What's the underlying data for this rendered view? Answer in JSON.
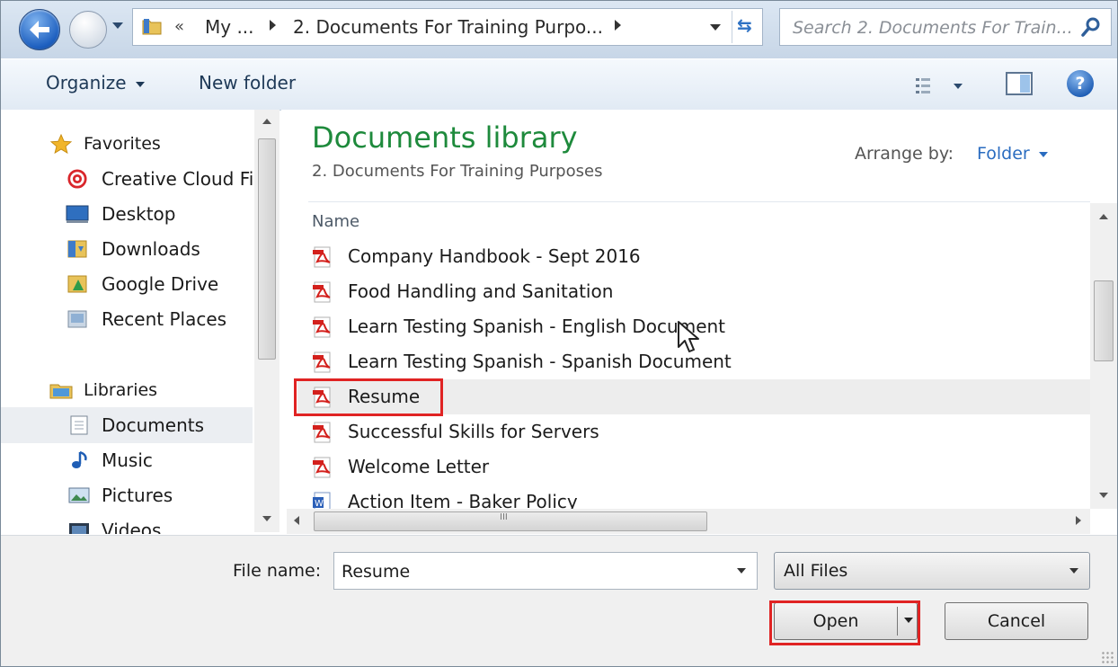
{
  "address": {
    "back_label": "Back",
    "overflow": "«",
    "crumbs": [
      "My ...",
      "2. Documents For Training Purpo..."
    ],
    "search_placeholder": "Search 2. Documents For Train..."
  },
  "toolbar": {
    "organize": "Organize",
    "new_folder": "New folder"
  },
  "nav": {
    "favorites": "Favorites",
    "creative_cloud": "Creative Cloud Fi",
    "desktop": "Desktop",
    "downloads": "Downloads",
    "google_drive": "Google Drive",
    "recent_places": "Recent Places",
    "libraries": "Libraries",
    "documents": "Documents",
    "music": "Music",
    "pictures": "Pictures",
    "videos": "Videos"
  },
  "library": {
    "title": "Documents library",
    "subtitle": "2. Documents For Training Purposes",
    "arrange_label": "Arrange by:",
    "arrange_value": "Folder",
    "column_name": "Name"
  },
  "files": [
    {
      "name": "Company Handbook - Sept 2016",
      "icon": "pdf-icon"
    },
    {
      "name": "Food Handling and Sanitation",
      "icon": "pdf-icon"
    },
    {
      "name": "Learn Testing Spanish - English Document",
      "icon": "pdf-icon"
    },
    {
      "name": "Learn Testing Spanish - Spanish Document",
      "icon": "pdf-icon"
    },
    {
      "name": "Resume",
      "icon": "pdf-icon",
      "selected": true
    },
    {
      "name": "Successful Skills for Servers",
      "icon": "pdf-icon"
    },
    {
      "name": "Welcome Letter",
      "icon": "pdf-icon"
    },
    {
      "name": "Action Item - Baker Policy",
      "icon": "word-doc-icon"
    }
  ],
  "hscroll_grip": "III",
  "bottom": {
    "file_name_label": "File name:",
    "file_name_value": "Resume",
    "file_type": "All Files",
    "open": "Open",
    "cancel": "Cancel"
  },
  "colors": {
    "library_title": "#1e8a3c",
    "highlight": "#e02323",
    "accent_blue": "#2a6cc0"
  }
}
